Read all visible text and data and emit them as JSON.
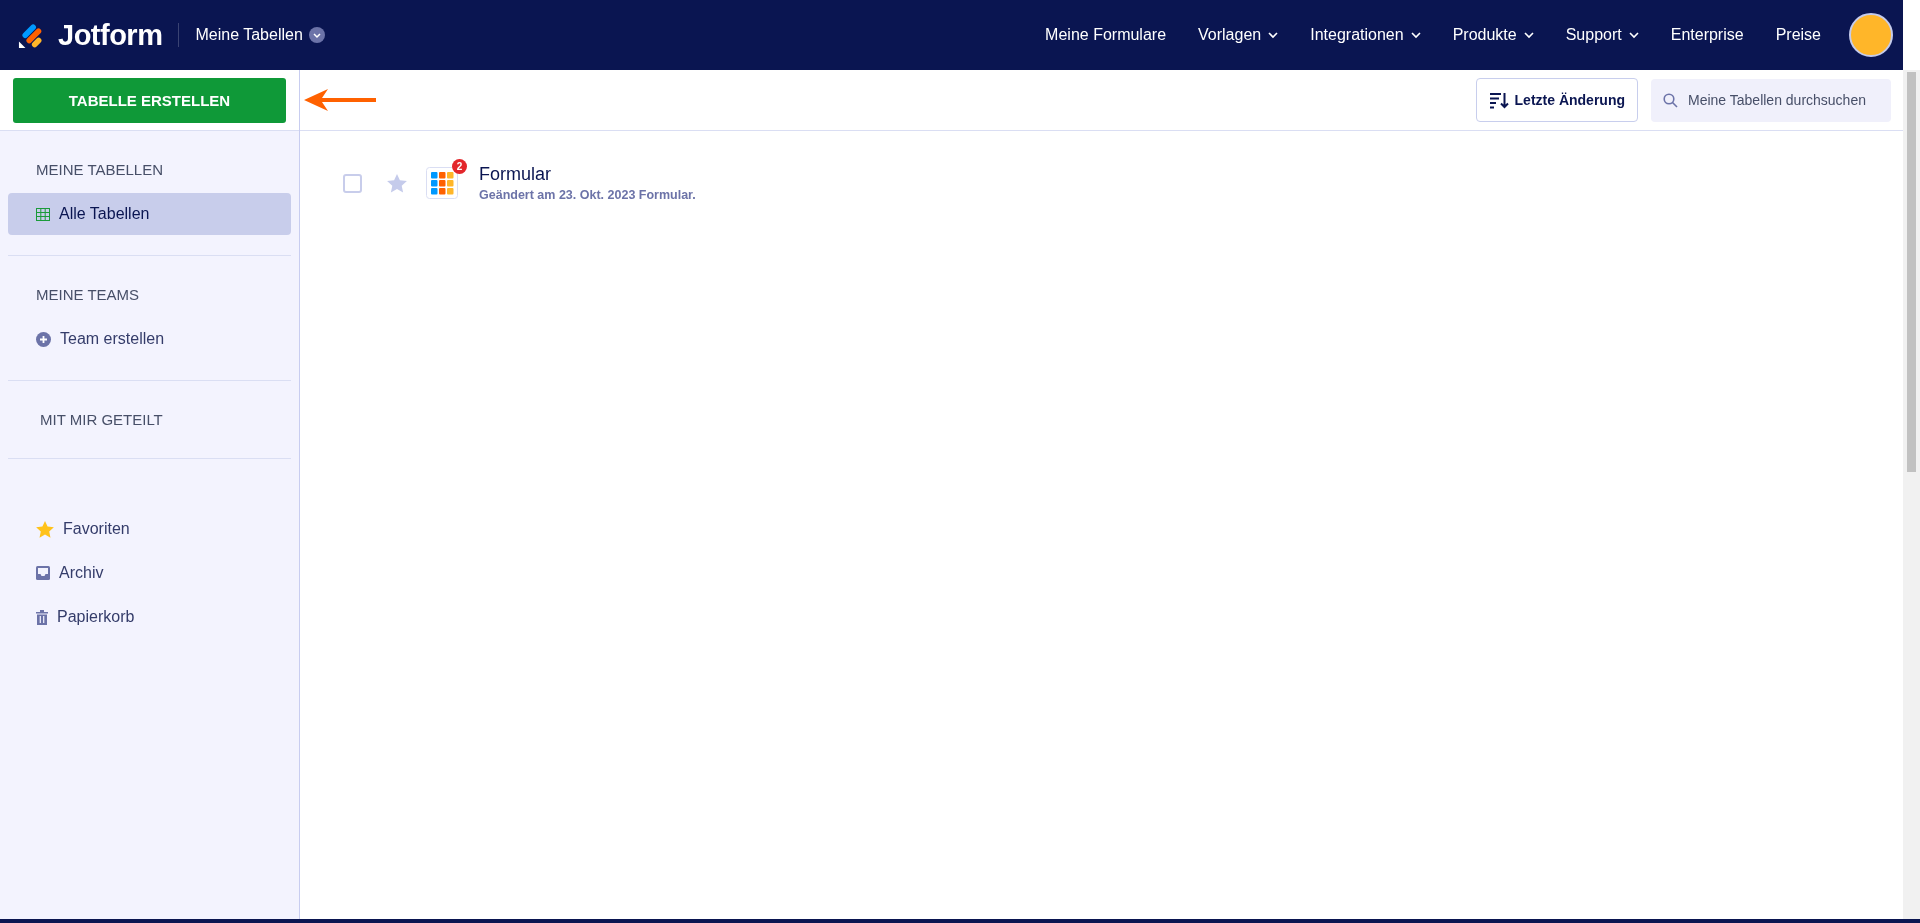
{
  "header": {
    "brand": "Jotform",
    "context": "Meine Tabellen",
    "nav": [
      {
        "label": "Meine Formulare",
        "kind": "link"
      },
      {
        "label": "Vorlagen",
        "kind": "dropdown"
      },
      {
        "label": "Integrationen",
        "kind": "dropdown"
      },
      {
        "label": "Produkte",
        "kind": "dropdown"
      },
      {
        "label": "Support",
        "kind": "dropdown"
      },
      {
        "label": "Enterprise",
        "kind": "link"
      },
      {
        "label": "Preise",
        "kind": "link"
      }
    ]
  },
  "create_button": "TABELLE ERSTELLEN",
  "toolbar": {
    "sort": "Letzte Änderung",
    "search": {
      "placeholder": "Meine Tabellen durchsuchen"
    }
  },
  "sidebar": {
    "sections": [
      {
        "heading": "MEINE TABELLEN",
        "items": [
          {
            "label": "Alle Tabellen",
            "kind": "grid",
            "selected": true
          }
        ]
      },
      {
        "heading": "MEINE TEAMS",
        "items": [
          {
            "label": "Team erstellen",
            "kind": "plus",
            "selected": false
          }
        ]
      },
      {
        "heading": "MIT MIR GETEILT"
      },
      {
        "items": [
          {
            "label": "Favoriten",
            "kind": "star",
            "selected": false
          },
          {
            "label": "Archiv",
            "kind": "archive",
            "selected": false
          },
          {
            "label": "Papierkorb",
            "kind": "trash",
            "selected": false
          }
        ]
      }
    ]
  },
  "tables": [
    {
      "title": "Formular",
      "subtitle": "Geändert am 23. Okt. 2023 Formular.",
      "badge": "2",
      "checked": false,
      "starred": false
    }
  ]
}
